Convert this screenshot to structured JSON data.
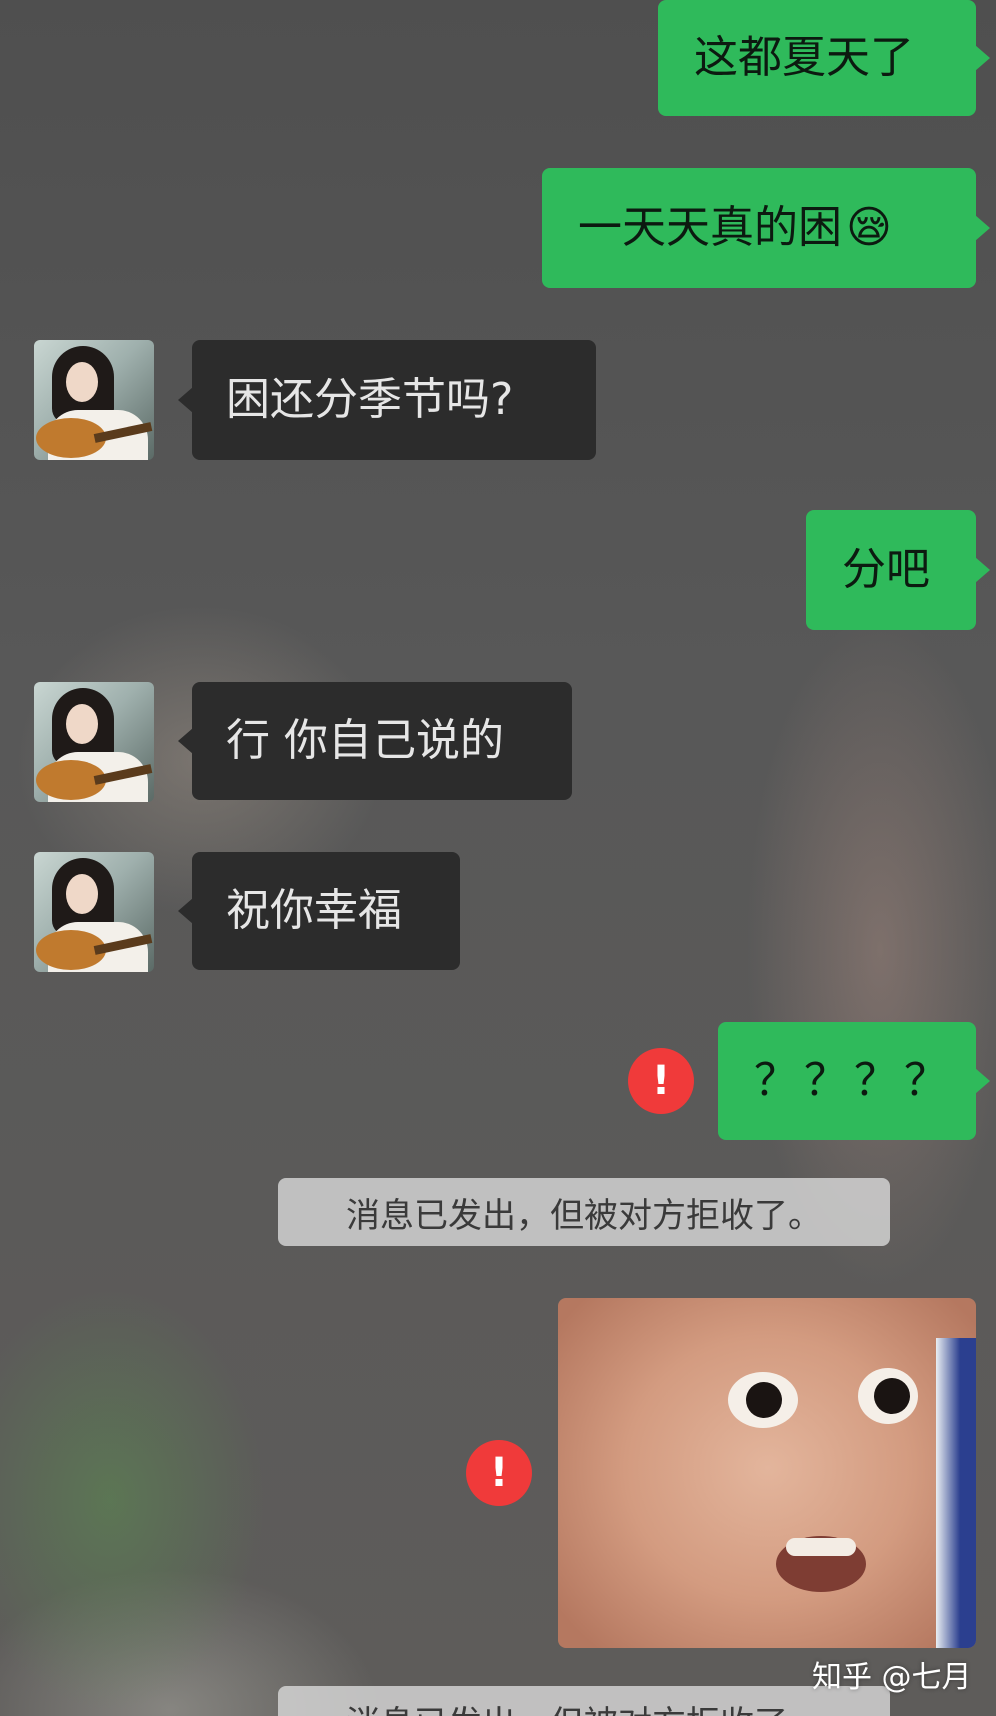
{
  "messages": [
    {
      "side": "out",
      "text": "这都夏天了"
    },
    {
      "side": "out",
      "text": "一天天真的困",
      "emoji": "😪"
    },
    {
      "side": "in",
      "text": "困还分季节吗?"
    },
    {
      "side": "out",
      "text": "分吧"
    },
    {
      "side": "in",
      "text": "行 你自己说的"
    },
    {
      "side": "in",
      "text": "祝你幸福"
    },
    {
      "side": "out",
      "text": "？？？？",
      "failed": true
    },
    {
      "side": "out",
      "type": "sticker",
      "failed": true
    }
  ],
  "system_notes": [
    "消息已发出，但被对方拒收了。",
    "消息已发出，但被对方拒收了。"
  ],
  "error_symbol": "!",
  "watermark": "知乎 @七月",
  "colors": {
    "outgoing_bubble": "#2fba5b",
    "incoming_bubble": "#2c2c2c",
    "error": "#f03a3a",
    "system_note": "#d7d7d7"
  },
  "icons": {
    "failed_send": "exclamation-circle-icon"
  }
}
